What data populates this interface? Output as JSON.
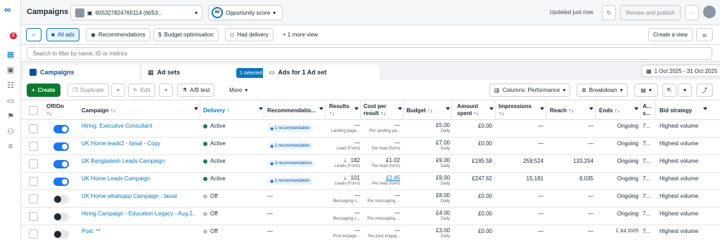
{
  "brand": {
    "icon": "meta-logo-icon",
    "glyph": "∞"
  },
  "app": {
    "title": "Campaigns",
    "account_id": "605327824765114 (6053...",
    "score_value": "90",
    "score_label": "Opportunity score"
  },
  "rail": {
    "notif_count": "2"
  },
  "header": {
    "updated_text": "Updated just now",
    "review_label": "Review and publish",
    "more_label": "···"
  },
  "toolbar": {
    "all_ads": "All ads",
    "recommendations": "Recommendations",
    "budget": "Budget optimisation",
    "had_delivery": "Had delivery",
    "more_view": "+  1 more view",
    "create_view": "Create a view"
  },
  "search": {
    "placeholder": "Search to filter by name, ID or metrics"
  },
  "tabs": {
    "campaigns": "Campaigns",
    "adsets": "Ad sets",
    "selected": "1 selected",
    "ads": "Ads for 1 Ad set"
  },
  "date_range": "1 Oct 2025 - 31 Oct 2025",
  "actions": {
    "create": "Create",
    "duplicate": "Duplicate",
    "edit": "Edit",
    "abtest": "A/B test",
    "more": "More",
    "columns": "Columns: Performance",
    "breakdown": "Breakdown"
  },
  "columns": {
    "offon": "Off/On",
    "offon2": "↑↓",
    "campaign": "Campaign ↑↓",
    "delivery": "Delivery ↑",
    "recommendations": "Recommendatio...",
    "results": "Results",
    "results2": "↑↓",
    "cost": "Cost per",
    "cost2": "result ↑↓",
    "budget": "Budget ↑↓",
    "amount": "Amount",
    "amount2": "spent ↑↓",
    "impressions": "Impressions",
    "impressions2": "↑↓",
    "reach": "Reach ↑↓",
    "ends": "Ends ↑↓",
    "as": "A...",
    "as2": "s...",
    "bid": "Bid strategy"
  },
  "rows": [
    {
      "on": true,
      "campaign": "Hiring: Executive Consultant",
      "delivery": "Active",
      "delivery_on": true,
      "rec": "1 recommendation",
      "results": "—",
      "results_sub": "Landing page...",
      "cost": "—",
      "cost_sub": "Per landing pa...",
      "budget": "£5.00",
      "budget_sub": "Daily",
      "spent": "£0.00",
      "impr": "—",
      "reach": "—",
      "ends": "Ongoing",
      "as": "7...",
      "bid": "Highest volume"
    },
    {
      "on": true,
      "campaign": "UK Home leads2 - faisal - Copy",
      "delivery": "Active",
      "delivery_on": true,
      "rec": "1 recommendation",
      "results": "—",
      "results_sub": "Lead (Form)",
      "cost": "—",
      "cost_sub": "Per lead (form)",
      "budget": "£7.00",
      "budget_sub": "Daily",
      "spent": "£0.00",
      "impr": "—",
      "reach": "—",
      "ends": "Ongoing",
      "as": "7...",
      "bid": "Highest volume"
    },
    {
      "on": true,
      "campaign": "UK Bangladesh Leads Campaign",
      "delivery": "Active",
      "delivery_on": true,
      "rec": "3 recommendations",
      "results": "182",
      "results_sub": "Leads (Form)",
      "cost": "£1.02",
      "cost_sub": "Per lead (form)",
      "budget": "£9.00",
      "budget_sub": "Daily",
      "spent": "£185.58",
      "impr": "259,524",
      "reach": "133,254",
      "ends": "Ongoing",
      "as": "7...",
      "bid": "Highest volume"
    },
    {
      "on": true,
      "campaign": "UK Home Leads Campaign",
      "delivery": "Active",
      "delivery_on": true,
      "rec": "1 recommendation",
      "results": "101",
      "results_sub": "Leads (Form)",
      "cost": "£2.45",
      "cost_sub": "Per lead (form)",
      "budget": "£9.00",
      "budget_sub": "Daily",
      "spent": "£247.62",
      "impr": "15,181",
      "reach": "8,035",
      "ends": "Ongoing",
      "as": "7...",
      "bid": "Highest volume"
    },
    {
      "on": false,
      "campaign": "UK Home whatsapp Campaign - faisal",
      "delivery": "Off",
      "delivery_on": false,
      "rec": "—",
      "results": "—",
      "results_sub": "Messaging c...",
      "cost": "—",
      "cost_sub": "Per messaging ...",
      "budget": "£8.00",
      "budget_sub": "Daily",
      "spent": "£0.00",
      "impr": "—",
      "reach": "—",
      "ends": "Ongoing",
      "as": "7...",
      "bid": "Highest volume"
    },
    {
      "on": false,
      "campaign": "Hiring Campaign - Education Legacy - Aug 2...",
      "delivery": "Off",
      "delivery_on": false,
      "rec": "—",
      "results": "—",
      "results_sub": "Messaging c...",
      "cost": "—",
      "cost_sub": "Per messaging ...",
      "budget": "£4.00",
      "budget_sub": "Daily",
      "spent": "£0.00",
      "impr": "—",
      "reach": "—",
      "ends": "Ongoing",
      "as": "7...",
      "bid": "Highest volume"
    },
    {
      "on": false,
      "campaign": "Post: **",
      "delivery": "Off",
      "delivery_on": false,
      "rec": "—",
      "results": "—",
      "results_sub": "Post engage...",
      "cost": "—",
      "cost_sub": "Per post engag...",
      "budget": "£3.00",
      "budget_sub": "Daily",
      "spent": "£0.00",
      "impr": "—",
      "reach": "—",
      "ends": "1 Jul 2025",
      "as": "7...",
      "bid": "Highest volume"
    }
  ]
}
